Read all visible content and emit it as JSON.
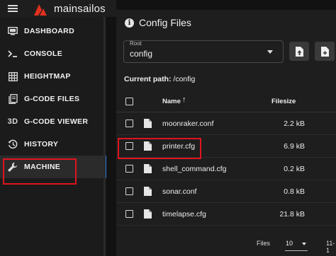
{
  "app": {
    "brand": "mainsailos"
  },
  "sidebar": {
    "items": [
      {
        "label": "DASHBOARD",
        "icon": "dashboard-icon"
      },
      {
        "label": "CONSOLE",
        "icon": "console-icon"
      },
      {
        "label": "HEIGHTMAP",
        "icon": "grid-icon"
      },
      {
        "label": "G-CODE FILES",
        "icon": "files-icon"
      },
      {
        "label": "G-CODE VIEWER",
        "icon": "3d-icon",
        "glyph": "3D"
      },
      {
        "label": "HISTORY",
        "icon": "history-icon"
      },
      {
        "label": "MACHINE",
        "icon": "wrench-icon",
        "active": true
      }
    ]
  },
  "main": {
    "title": "Config Files",
    "root_select": {
      "label": "Root",
      "value": "config"
    },
    "current_path_label": "Current path:",
    "current_path": "/config"
  },
  "table": {
    "headers": {
      "name": "Name",
      "size": "Filesize"
    },
    "rows": [
      {
        "name": "moonraker.conf",
        "size": "2.2 kB"
      },
      {
        "name": "printer.cfg",
        "size": "6.9 kB"
      },
      {
        "name": "shell_command.cfg",
        "size": "0.2 kB"
      },
      {
        "name": "sonar.conf",
        "size": "0.8 kB"
      },
      {
        "name": "timelapse.cfg",
        "size": "21.8 kB"
      }
    ]
  },
  "footer": {
    "files_label": "Files",
    "per_page": "10",
    "range": "11-1"
  },
  "colors": {
    "accent": "#2e78d2",
    "highlight": "#e0141e",
    "logo": "#e0301e"
  }
}
